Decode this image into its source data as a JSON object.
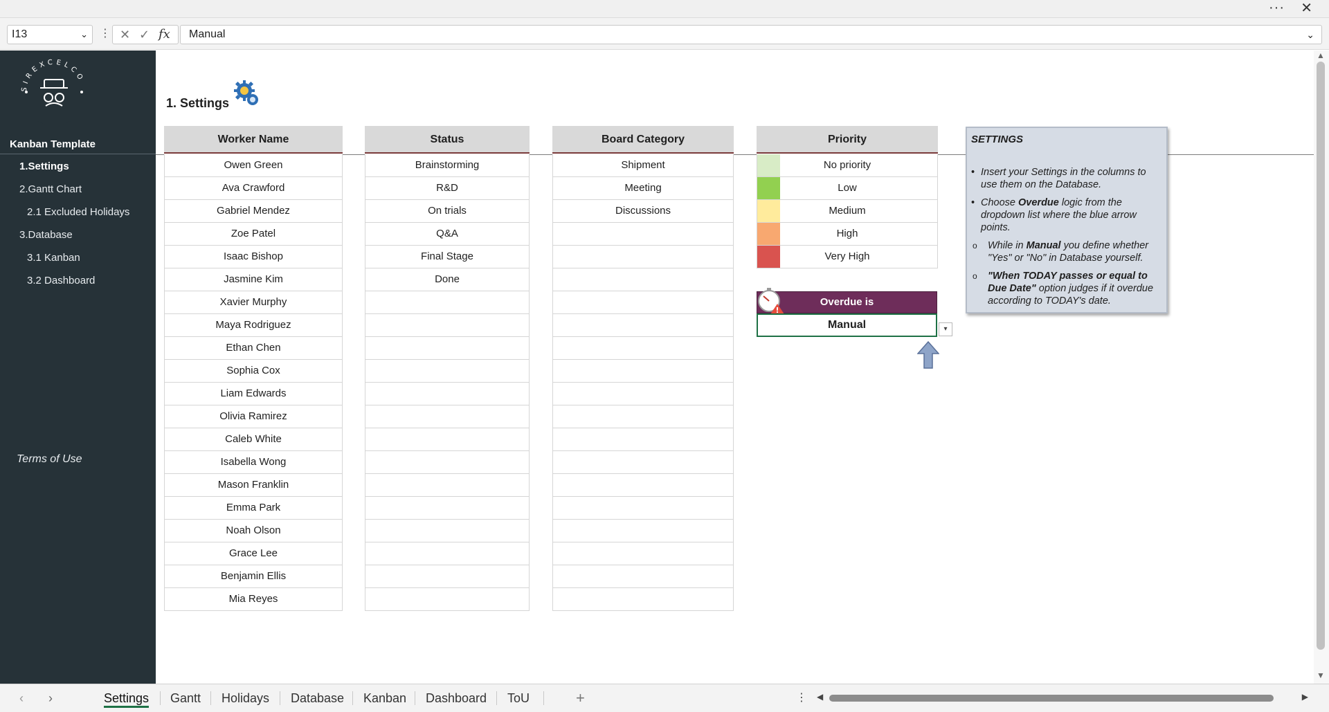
{
  "window": {
    "more_glyph": "···",
    "close_glyph": "✕"
  },
  "formula_bar": {
    "name_box": "I13",
    "cancel_glyph": "✕",
    "enter_glyph": "✓",
    "fx_label": "fx",
    "value": "Manual"
  },
  "sidebar": {
    "title": "Kanban Template",
    "items": [
      {
        "label": "1.Settings",
        "bold": true
      },
      {
        "label": "2.Gantt Chart"
      },
      {
        "label": "2.1 Excluded Holidays"
      },
      {
        "label": "3.Database"
      },
      {
        "label": "3.1 Kanban"
      },
      {
        "label": "3.2 Dashboard"
      }
    ],
    "terms": "Terms of Use",
    "logo_text": "SIREXCELCO"
  },
  "page": {
    "title": "1. Settings"
  },
  "tables": {
    "worker": {
      "header": "Worker Name",
      "rows": [
        "Owen Green",
        "Ava Crawford",
        "Gabriel Mendez",
        "Zoe Patel",
        "Isaac Bishop",
        "Jasmine Kim",
        "Xavier Murphy",
        "Maya Rodriguez",
        "Ethan Chen",
        "Sophia Cox",
        "Liam Edwards",
        "Olivia Ramirez",
        "Caleb White",
        "Isabella Wong",
        "Mason Franklin",
        "Emma Park",
        "Noah Olson",
        "Grace Lee",
        "Benjamin Ellis",
        "Mia Reyes"
      ]
    },
    "status": {
      "header": "Status",
      "rows": [
        "Brainstorming",
        "R&D",
        "On trials",
        "Q&A",
        "Final Stage",
        "Done",
        "",
        "",
        "",
        "",
        "",
        "",
        "",
        "",
        "",
        "",
        "",
        "",
        "",
        ""
      ]
    },
    "category": {
      "header": "Board Category",
      "rows": [
        "Shipment",
        "Meeting",
        "Discussions",
        "",
        "",
        "",
        "",
        "",
        "",
        "",
        "",
        "",
        "",
        "",
        "",
        "",
        "",
        "",
        "",
        ""
      ]
    },
    "priority": {
      "header": "Priority",
      "rows": [
        {
          "label": "No priority",
          "color": "#d8ecc6"
        },
        {
          "label": "Low",
          "color": "#92d050"
        },
        {
          "label": "Medium",
          "color": "#ffeb9c"
        },
        {
          "label": "High",
          "color": "#f8a870"
        },
        {
          "label": "Very High",
          "color": "#d9534f"
        }
      ]
    }
  },
  "overdue": {
    "header": "Overdue is",
    "value": "Manual"
  },
  "note": {
    "title": "SETTINGS",
    "b1": "Insert your Settings in the columns to use them on the Database.",
    "b2_pre": "Choose ",
    "b2_bold": "Overdue",
    "b2_post": " logic from the dropdown list where the blue arrow points.",
    "c1_pre": "While in ",
    "c1_bold": "Manual",
    "c1_post": " you define whether \"Yes\" or \"No\" in Database yourself.",
    "c2_bold": "\"When TODAY passes or equal to Due Date\"",
    "c2_post": " option judges if it overdue according to TODAY's date."
  },
  "sheet_tabs": [
    "Settings",
    "Gantt",
    "Holidays",
    "Database",
    "Kanban",
    "Dashboard",
    "ToU"
  ],
  "active_tab": "Settings",
  "colors": {
    "sidebar": "#263238",
    "accent_green": "#1e7145",
    "overdue_head": "#6e2d5a",
    "note_bg": "#d6dce5"
  }
}
